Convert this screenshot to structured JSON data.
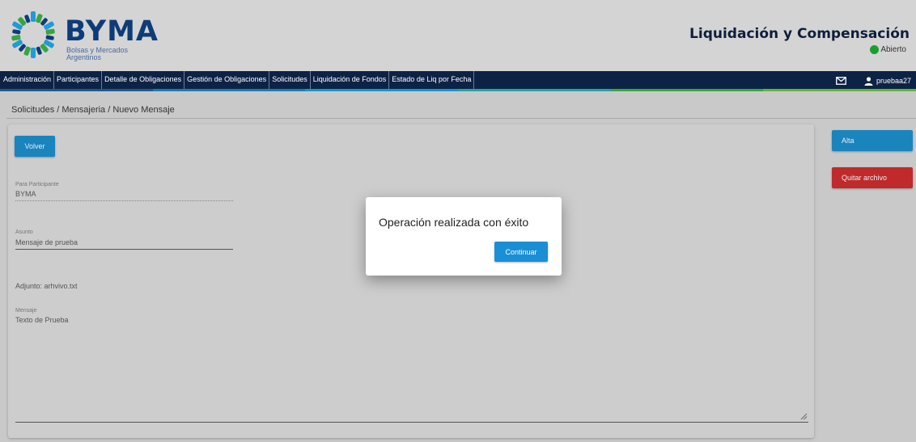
{
  "header": {
    "brand_name": "BYMA",
    "brand_sub_line1": "Bolsas y Mercados",
    "brand_sub_line2": "Argentinos",
    "app_title": "Liquidación y Compensación",
    "status_label": "Abierto",
    "status_color": "#1a9f2a"
  },
  "navbar": {
    "items": [
      "Administración",
      "Participantes",
      "Detalle de Obligaciones",
      "Gestión de Obligaciones",
      "Solicitudes",
      "Liquidación de Fondos",
      "Estado de Liq por Fecha"
    ],
    "user": "pruebaa27",
    "mail_icon": "envelope-icon",
    "user_icon": "user-icon"
  },
  "breadcrumb": "Solicitudes / Mensajeria / Nuevo Mensaje",
  "form": {
    "back_label": "Volver",
    "participant_label": "Para Participante",
    "participant_value": "BYMA",
    "subject_label": "Asunto",
    "subject_value": "Mensaje de prueba",
    "attachment_text": "Adjunto: arhvivo.txt",
    "message_label": "Mensaje",
    "message_value": "Texto de Prueba"
  },
  "side_buttons": {
    "alta_label": "Alta",
    "quitar_label": "Quitar archivo"
  },
  "modal": {
    "message": "Operación realizada con éxito",
    "continue_label": "Continuar"
  },
  "colors": {
    "nav_bg": "#0d2346",
    "primary_button": "#1a84bd",
    "danger_button": "#c02a2a",
    "brand_blue": "#0d3c78"
  }
}
